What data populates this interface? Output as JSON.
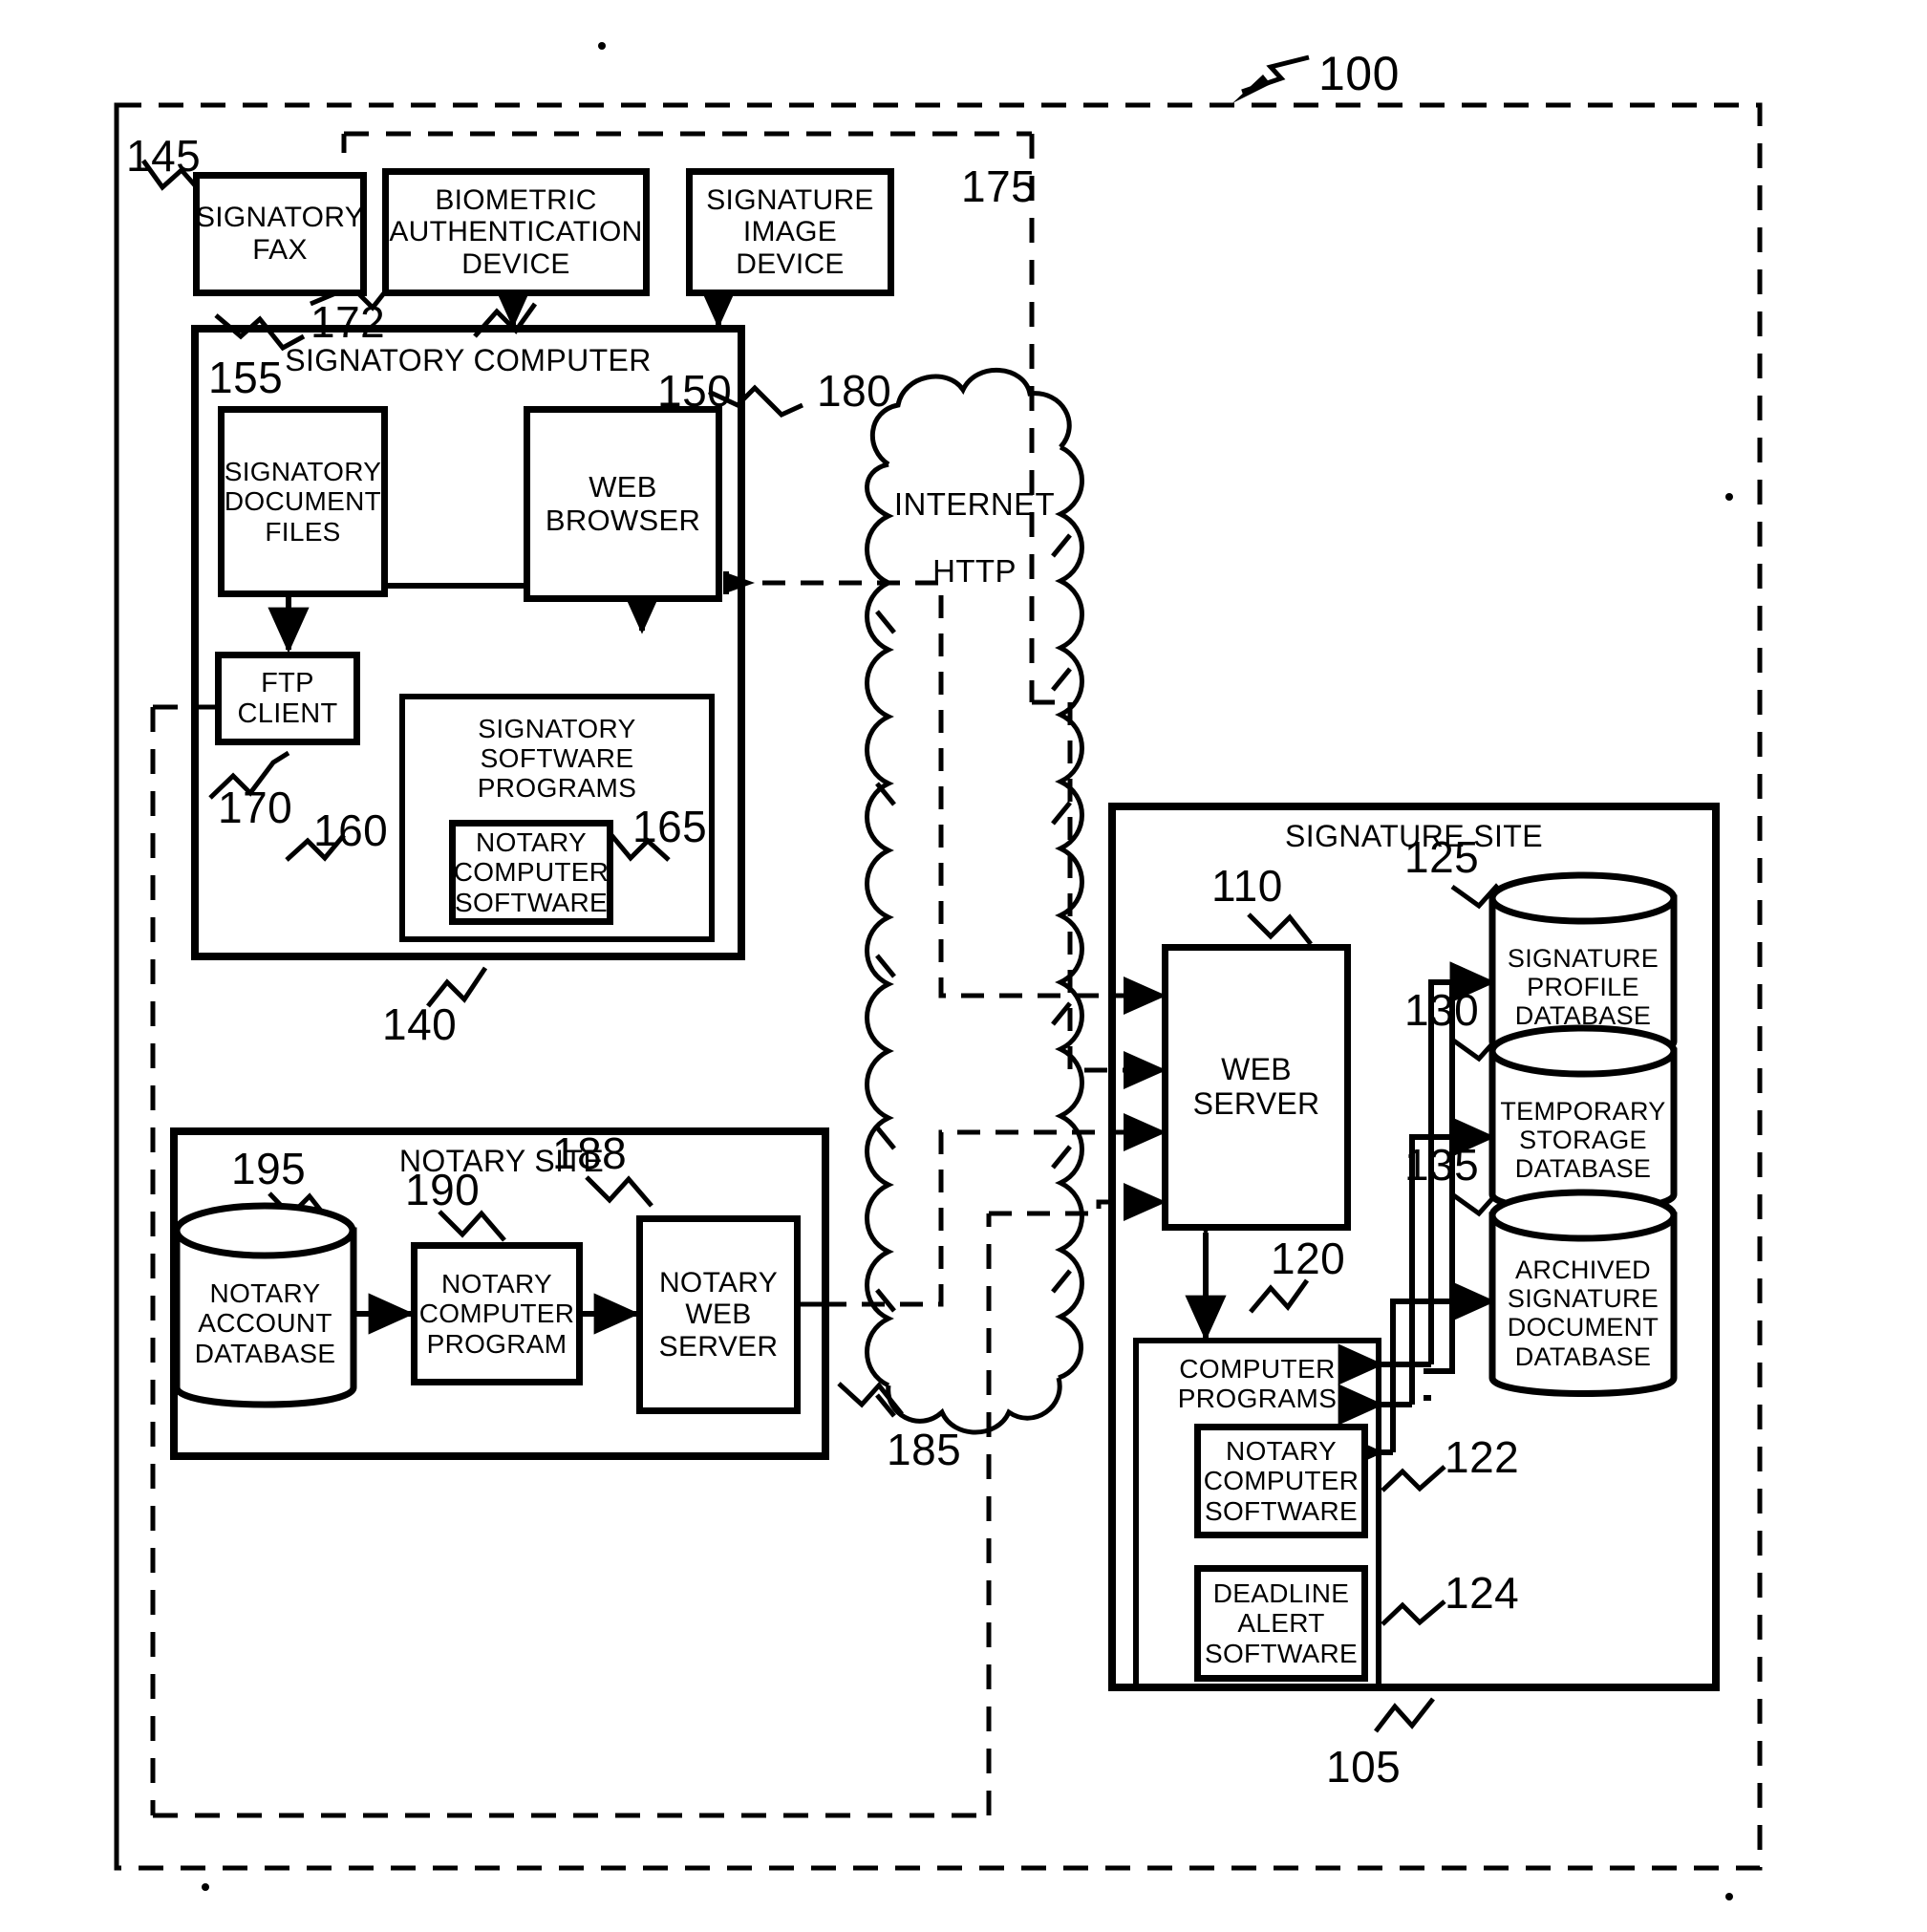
{
  "figure": {
    "system_ref": "100",
    "refs": {
      "system": "100",
      "signature_site": "105",
      "web_server": "110",
      "computer_programs": "120",
      "notary_computer_software_site": "122",
      "deadline_alert_software": "124",
      "signature_profile_database": "125",
      "temporary_storage_database": "130",
      "archived_signature_document_database": "135",
      "signatory_computer": "140",
      "signatory_environment": "145",
      "web_browser": "150",
      "signatory_document_files": "155",
      "signatory_software_programs": "160",
      "notary_computer_software": "165",
      "ftp_client": "170",
      "biometric_authentication_device": "172",
      "signature_image_device": "175",
      "internet": "180",
      "notary_internet_link": "185",
      "notary_web_server": "188",
      "notary_computer_program": "190",
      "notary_account_database": "195"
    }
  },
  "signatory": {
    "fax": "SIGNATORY\nFAX",
    "biometric_device": "BIOMETRIC\nAUTHENTICATION\nDEVICE",
    "signature_image_device": "SIGNATURE\nIMAGE\nDEVICE",
    "computer_title": "SIGNATORY COMPUTER",
    "document_files": "SIGNATORY\nDOCUMENT\nFILES",
    "web_browser": "WEB\nBROWSER",
    "ftp_client": "FTP\nCLIENT",
    "software_programs_title": "SIGNATORY SOFTWARE\nPROGRAMS",
    "notary_computer_software": "NOTARY\nCOMPUTER\nSOFTWARE"
  },
  "network": {
    "cloud_label_1": "INTERNET",
    "cloud_label_2": "HTTP"
  },
  "signature_site": {
    "title": "SIGNATURE  SITE",
    "web_server": "WEB\nSERVER",
    "computer_programs_title": "COMPUTER\nPROGRAMS",
    "notary_computer_software": "NOTARY\nCOMPUTER\nSOFTWARE",
    "deadline_alert_software": "DEADLINE\nALERT\nSOFTWARE",
    "databases": [
      "SIGNATURE\nPROFILE\nDATABASE",
      "TEMPORARY\nSTORAGE\nDATABASE",
      "ARCHIVED\nSIGNATURE\nDOCUMENT\nDATABASE"
    ]
  },
  "notary_site": {
    "title": "NOTARY SITE",
    "account_database": "NOTARY\nACCOUNT\nDATABASE",
    "computer_program": "NOTARY\nCOMPUTER\nPROGRAM",
    "web_server": "NOTARY\nWEB\nSERVER"
  }
}
